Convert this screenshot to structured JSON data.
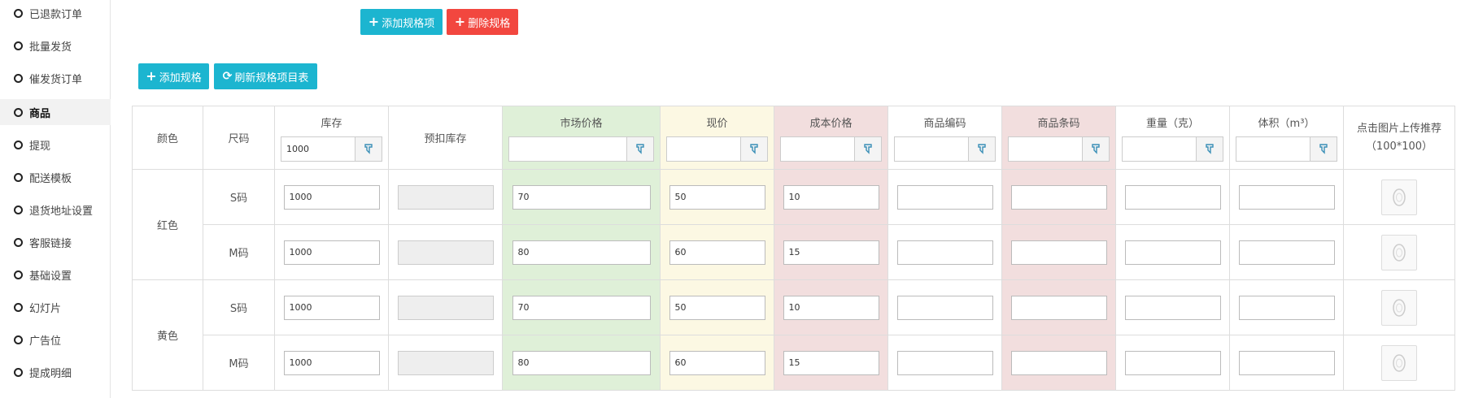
{
  "sidebar": {
    "items": [
      {
        "label": "已退款订单",
        "active": false
      },
      {
        "label": "批量发货",
        "active": false
      },
      {
        "label": "催发货订单",
        "active": false
      },
      {
        "label": "商品",
        "active": true
      },
      {
        "label": "提现",
        "active": false
      },
      {
        "label": "配送模板",
        "active": false
      },
      {
        "label": "退货地址设置",
        "active": false
      },
      {
        "label": "客服链接",
        "active": false
      },
      {
        "label": "基础设置",
        "active": false
      },
      {
        "label": "幻灯片",
        "active": false
      },
      {
        "label": "广告位",
        "active": false
      },
      {
        "label": "提成明细",
        "active": false
      }
    ]
  },
  "toolbar_top": {
    "add_spec_item": "添加规格项",
    "delete_spec": "删除规格"
  },
  "toolbar": {
    "add_spec": "添加规格",
    "refresh_table": "刷新规格项目表"
  },
  "table": {
    "headers": {
      "color": "颜色",
      "size": "尺码",
      "stock": "库存",
      "reserved_stock": "预扣库存",
      "market_price": "市场价格",
      "current_price": "现价",
      "cost_price": "成本价格",
      "product_code": "商品编码",
      "barcode": "商品条码",
      "weight": "重量（克）",
      "volume": "体积（m³）",
      "image_tip": "点击图片上传推荐（100*100）"
    },
    "batch": {
      "stock": "1000",
      "market_price": "",
      "current_price": "",
      "cost_price": "",
      "product_code": "",
      "barcode": "",
      "weight": "",
      "volume": ""
    },
    "groups": [
      {
        "color": "红色",
        "rows": [
          {
            "size": "S码",
            "stock": "1000",
            "reserved": "",
            "market_price": "70",
            "current_price": "50",
            "cost_price": "10",
            "code": "",
            "barcode": "",
            "weight": "",
            "volume": ""
          },
          {
            "size": "M码",
            "stock": "1000",
            "reserved": "",
            "market_price": "80",
            "current_price": "60",
            "cost_price": "15",
            "code": "",
            "barcode": "",
            "weight": "",
            "volume": ""
          }
        ]
      },
      {
        "color": "黄色",
        "rows": [
          {
            "size": "S码",
            "stock": "1000",
            "reserved": "",
            "market_price": "70",
            "current_price": "50",
            "cost_price": "10",
            "code": "",
            "barcode": "",
            "weight": "",
            "volume": ""
          },
          {
            "size": "M码",
            "stock": "1000",
            "reserved": "",
            "market_price": "80",
            "current_price": "60",
            "cost_price": "15",
            "code": "",
            "barcode": "",
            "weight": "",
            "volume": ""
          }
        ]
      }
    ]
  },
  "colors": {
    "cyan": "#1cb5d0",
    "red": "#f2473f",
    "green_col": "#dff0d8",
    "yellow_col": "#fcf8e3",
    "red_col": "#f2dede"
  }
}
